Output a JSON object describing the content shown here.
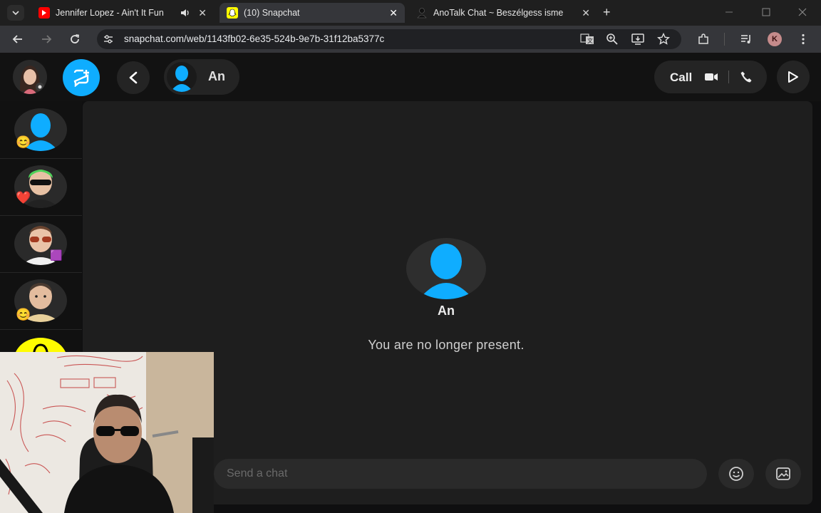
{
  "browser": {
    "tabs": [
      {
        "title": "Jennifer Lopez - Ain't It Fun",
        "favicon": "youtube-icon",
        "audio": true
      },
      {
        "title": "(10) Snapchat",
        "favicon": "snapchat-icon",
        "active": true
      },
      {
        "title": "AnoTalk Chat ~ Beszélgess isme",
        "favicon": "anotalk-icon"
      }
    ],
    "url": "snapchat.com/web/1143fb02-6e35-524b-9e7b-31f12ba5377c",
    "profile_initial": "K"
  },
  "snapchat": {
    "contact_name": "An",
    "call_label": "Call",
    "status_message": "You are no longer present.",
    "chat_placeholder": "Send a chat",
    "accent": "#0fadff",
    "brand_yellow": "#fffc00"
  },
  "sidebar": {
    "friends": [
      {
        "badge": "😊"
      },
      {
        "badge": "❤️"
      },
      {
        "badge": "🟪"
      },
      {
        "badge": "😊"
      }
    ]
  }
}
